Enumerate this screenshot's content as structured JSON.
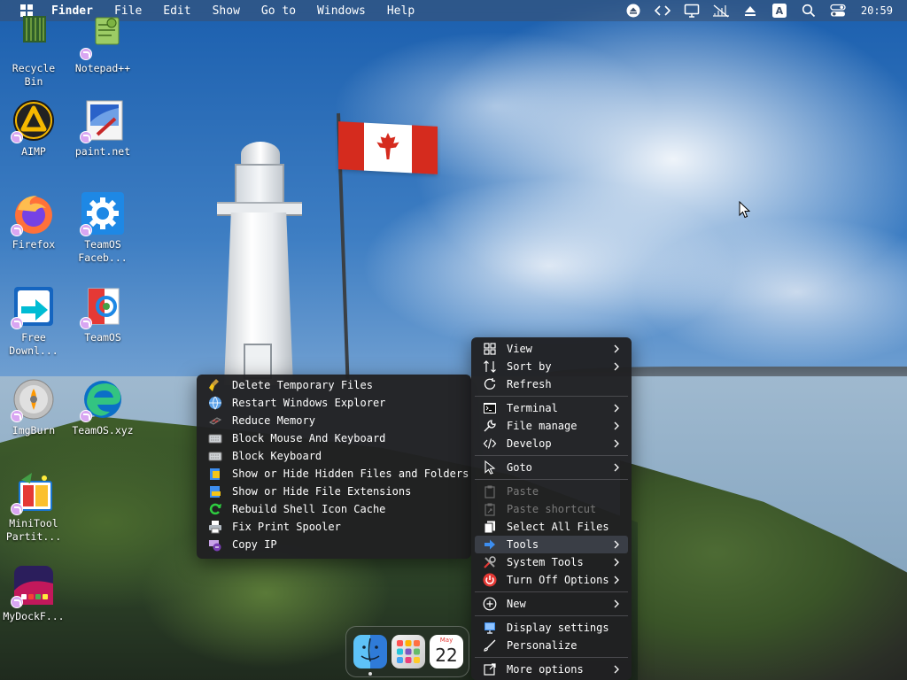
{
  "menubar": {
    "app_name": "Finder",
    "items": [
      "File",
      "Edit",
      "Show",
      "Go to",
      "Windows",
      "Help"
    ],
    "tray_icons": [
      "eject-icon",
      "code-icon",
      "display-icon",
      "network-off-icon",
      "upload-icon",
      "input-method-icon",
      "search-icon",
      "control-center-icon"
    ],
    "input_method_label": "A",
    "clock": "20:59"
  },
  "desktop_icons": [
    {
      "name": "recycle-bin",
      "label": "Recycle\nBin"
    },
    {
      "name": "notepad-plus-plus",
      "label": "Notepad++"
    },
    {
      "name": "aimp",
      "label": "AIMP"
    },
    {
      "name": "paint-net",
      "label": "paint.net"
    },
    {
      "name": "firefox",
      "label": "Firefox"
    },
    {
      "name": "teamos-facebook",
      "label": "TeamOS\nFaceb..."
    },
    {
      "name": "free-download-manager",
      "label": "Free\nDownl..."
    },
    {
      "name": "teamos",
      "label": "TeamOS"
    },
    {
      "name": "imgburn",
      "label": "ImgBurn"
    },
    {
      "name": "teamos-xyz",
      "label": "TeamOS.xyz"
    },
    {
      "name": "minitool-partition",
      "label": "MiniTool\nPartit..."
    },
    {
      "name": "mydockfinder",
      "label": "MyDockF..."
    }
  ],
  "tools_submenu": {
    "items": [
      {
        "label": "Delete Temporary Files",
        "icon": "broom-icon"
      },
      {
        "label": "Restart Windows Explorer",
        "icon": "globe-icon"
      },
      {
        "label": "Reduce Memory",
        "icon": "memory-icon"
      },
      {
        "label": "Block Mouse And Keyboard",
        "icon": "keyboard-icon"
      },
      {
        "label": "Block Keyboard",
        "icon": "keyboard-icon"
      },
      {
        "label": "Show or Hide Hidden Files and Folders",
        "icon": "hidden-files-icon"
      },
      {
        "label": "Show or Hide File Extensions",
        "icon": "file-extension-icon"
      },
      {
        "label": "Rebuild Shell Icon Cache",
        "icon": "refresh-icon"
      },
      {
        "label": "Fix Print Spooler",
        "icon": "printer-icon"
      },
      {
        "label": "Copy IP",
        "icon": "ip-icon"
      }
    ]
  },
  "context_menu": {
    "view": "View",
    "sort_by": "Sort by",
    "refresh": "Refresh",
    "terminal": "Terminal",
    "file_manage": "File manage",
    "develop": "Develop",
    "goto": "Goto",
    "paste": "Paste",
    "paste_shortcut": "Paste shortcut",
    "select_all_files": "Select All Files",
    "tools": "Tools",
    "system_tools": "System Tools",
    "turn_off_options": "Turn Off Options",
    "new": "New",
    "display_settings": "Display settings",
    "personalize": "Personalize",
    "more_options": "More options"
  },
  "dock": {
    "apps": [
      "finder",
      "launchpad",
      "calendar"
    ],
    "calendar_month": "May",
    "calendar_day": "22"
  },
  "colors": {
    "menu_bg": "#202022",
    "menu_hover": "#3a3e46",
    "disabled_text": "#7a7a7a",
    "accent_blue": "#3d8ef0"
  }
}
